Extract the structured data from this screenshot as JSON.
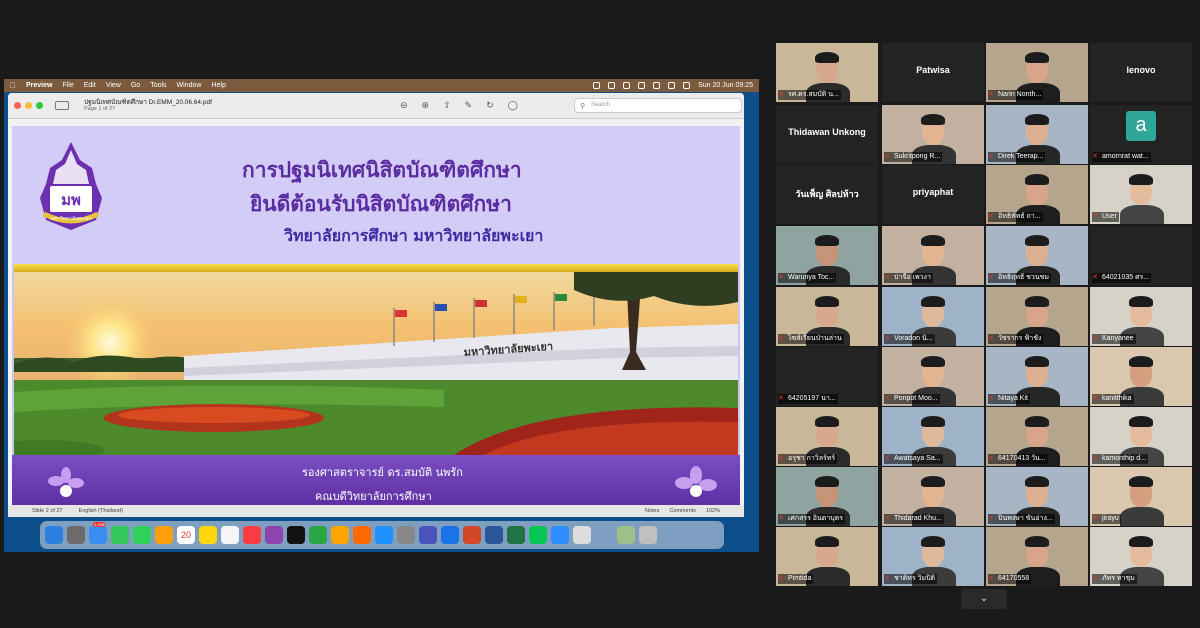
{
  "menubar": {
    "app": "Preview",
    "items": [
      "File",
      "Edit",
      "View",
      "Go",
      "Tools",
      "Window",
      "Help"
    ],
    "clock": "Sun 20 Jun  09:25"
  },
  "preview": {
    "file_name": "ปฐมนิเทศบัณฑิตศึกษา Dr.EMM_20.06.64.pdf",
    "page_info": "Page 1 of 27",
    "search_placeholder": "Search",
    "status_left": "Slide 2 of 27",
    "status_lang": "English (Thailand)",
    "status_notes": "Notes",
    "status_comments": "Comments",
    "zoom": "102%"
  },
  "slide": {
    "title1": "การปฐมนิเทศนิสิตบัณฑิตศึกษา",
    "title2": "ยินดีต้อนรับนิสิตบัณฑิตศึกษา",
    "title3": "วิทยาลัยการศึกษา มหาวิทยาลัยพะเยา",
    "presenter": "รองศาสตราจารย์ ดร.สมบัติ นพรัก",
    "faculty": "คณบดีวิทยาลัยการศึกษา",
    "logo_text": "มพ",
    "logo_sub": "มหาวิทยาลัยพะเยา",
    "sign_text": "มหาวิทยาลัยพะเยา"
  },
  "dock": {
    "calendar_day": "20",
    "mail_badge": "1,498"
  },
  "participants": [
    {
      "name": "รศ.ดร.สมบัติ น...",
      "video": true,
      "speaking": true
    },
    {
      "name": "Patwisa",
      "video": false
    },
    {
      "name": "Narin Nonth...",
      "video": true
    },
    {
      "name": "lenovo",
      "video": false
    },
    {
      "name": "Thidawan Unkong",
      "video": false
    },
    {
      "name": "Sukritpong R...",
      "video": true
    },
    {
      "name": "Direk Teerap...",
      "video": true
    },
    {
      "name": "amornrat wat...",
      "video": false,
      "avatar": "a"
    },
    {
      "name": "วันเพ็ญ ศิลปห้าว",
      "video": false
    },
    {
      "name": "priyaphat",
      "video": false
    },
    {
      "name": "อิทธิพัทธ์ ถา...",
      "video": true
    },
    {
      "name": "User",
      "video": true
    },
    {
      "name": "Warunya Toc...",
      "video": true
    },
    {
      "name": "ปาจือ เพวงา",
      "video": true
    },
    {
      "name": "อิทธิฤทธิ์ ชวนชม",
      "video": true
    },
    {
      "name": "64021035 ศร...",
      "video": false
    },
    {
      "name": "ไซส์เรียนป่านล่าน",
      "video": true
    },
    {
      "name": "Voradon นิ...",
      "video": true
    },
    {
      "name": "วัชรากร ฟ้าชัง",
      "video": true
    },
    {
      "name": "Kanyanee",
      "video": true
    },
    {
      "name": "64205197 นา...",
      "video": false
    },
    {
      "name": "Ponpot Moo...",
      "video": true
    },
    {
      "name": "Nitaya Kit",
      "video": true
    },
    {
      "name": "kanitthika",
      "video": true
    },
    {
      "name": "อรุชา กาวิลร์ทร์",
      "video": true
    },
    {
      "name": "Awatsaya Sa...",
      "video": true
    },
    {
      "name": "64170413 วัน...",
      "video": true
    },
    {
      "name": "kamonthip d...",
      "video": true
    },
    {
      "name": "เศกสรร อินตาบุตร",
      "video": true
    },
    {
      "name": "Thidarad Khu...",
      "video": true
    },
    {
      "name": "ปิ่นพงษา ขันอ่าง...",
      "video": true
    },
    {
      "name": "jirayu",
      "video": true
    },
    {
      "name": "Pimtida",
      "video": true
    },
    {
      "name": "ชาติทร วิมปิติ",
      "video": true
    },
    {
      "name": "64170558",
      "video": true
    },
    {
      "name": "ภัทร หาชุม",
      "video": true
    }
  ]
}
